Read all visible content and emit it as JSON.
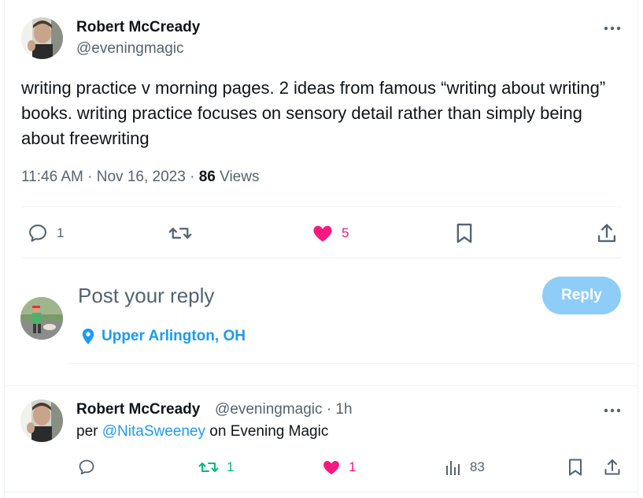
{
  "tweet": {
    "author_name": "Robert McCready",
    "author_handle": "@eveningmagic",
    "text": "writing practice v morning pages. 2 ideas from famous “writing about writing” books. writing practice focuses on sensory detail rather than simply being about freewriting",
    "time": "11:46 AM",
    "date": "Nov 16, 2023",
    "views_count": "86",
    "views_label": "Views",
    "reply_count": "1",
    "like_count": "5"
  },
  "composer": {
    "placeholder": "Post your reply",
    "reply_button": "Reply",
    "location": "Upper Arlington, OH"
  },
  "reply_tweet": {
    "author_name": "Robert McCready",
    "author_handle": "@eveningmagic",
    "separator": "·",
    "age": "1h",
    "text_prefix": "per ",
    "mention": "@NitaSweeney",
    "text_suffix": " on Evening Magic",
    "retweet_count": "1",
    "like_count": "1",
    "views_count": "83"
  },
  "colors": {
    "like": "#f91880",
    "retweet": "#00ba7c",
    "accent": "#1d9bf0",
    "reply_button": "#8ecdf8"
  },
  "icons": {
    "more": "more-dots-icon",
    "reply": "comment-icon",
    "retweet": "retweet-icon",
    "like": "heart-icon",
    "bookmark": "bookmark-icon",
    "share": "share-icon",
    "location": "location-pin-icon",
    "views": "views-bars-icon"
  }
}
